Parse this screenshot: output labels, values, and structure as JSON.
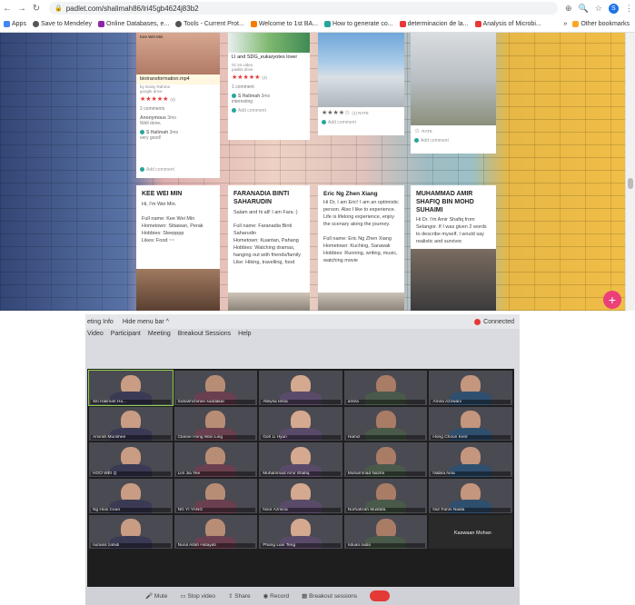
{
  "browser": {
    "url": "padlet.com/shalimah86/lri45gb4624j83b2",
    "bookmarks": [
      {
        "label": "Apps",
        "color": "#4285f4"
      },
      {
        "label": "Save to Mendeley",
        "color": "#555555"
      },
      {
        "label": "Online Databases, e...",
        "color": "#8e24aa"
      },
      {
        "label": "Tools - Current Prot...",
        "color": "#555555"
      },
      {
        "label": "Welcome to 1st BA...",
        "color": "#f57c00"
      },
      {
        "label": "How to generate co...",
        "color": "#26a69a"
      },
      {
        "label": "determinacion de la...",
        "color": "#e53935"
      },
      {
        "label": "Analysis of Microbi...",
        "color": "#e53935"
      }
    ],
    "other_bookmarks": "Other bookmarks",
    "profile_letter": "S"
  },
  "padlet": {
    "top_cards": [
      {
        "header": "Kee Wei Min",
        "title": "biotransformation.mp4",
        "by": "by Daisy Rahma",
        "source": "google drive",
        "comments_count": "2 comments",
        "comments": [
          {
            "author": "Anonymous",
            "time": "3mo",
            "text": "Well done,"
          },
          {
            "author": "S Halimah",
            "time": "3mo",
            "text": "very good!"
          }
        ],
        "add": "Add comment"
      },
      {
        "title": "LI and SDG_eukaryotes lover",
        "sub1": "01:44 video",
        "sub2": "padlet drive",
        "comments_count": "1 comment",
        "comments": [
          {
            "author": "S Halimah",
            "time": "3mo",
            "text": "interesting"
          }
        ],
        "add": "Add comment"
      },
      {
        "rate": "RATE",
        "add": "Add comment"
      },
      {
        "rate": "RATE",
        "add": "Add comment"
      }
    ],
    "bottom_cards": [
      {
        "name": "KEE WEI MIN",
        "body": "Hi, I'm Wei Min.\n\nFull name: Kee Wei Min\nHometown: Sitiawan, Perak\nHobbies: Sleepppp\nLikes: Food ~~"
      },
      {
        "name": "FARANADIA BINTI SAHARUDIN",
        "body": "Salam and hi all! I am Fara :)\n\nFull name: Faranadia Binti Saharudin\nHometown: Kuantan, Pahang\nHobbies: Watching dramas, hanging out with friends/family\nLike: Hiking, travelling, food"
      },
      {
        "name": "Eric Ng Zhen Xiang",
        "body": "Hi Dr, I am Eric! I am an optimistic person. Also I like to experience.\nLife is lifelong experience, enjoy the scenary along the journey.\n\nFull name: Eric Ng Zhen Xiang\nHometown: Kuching, Sarawak\nHobbies: Running, writing, music, watching movie"
      },
      {
        "name": "MUHAMMAD AMIR SHAFIQ BIN MOHD SUHAIMI",
        "body": "Hi Dr. I'm Amir Shafiq from Selangor. If I was given 2 words to describe myself, I would say realistic and survivor."
      }
    ]
  },
  "zoom": {
    "menu1": [
      "eting Info",
      "Hide menu bar ^"
    ],
    "connected": "Connected",
    "menu2": [
      "Video",
      "Participant",
      "Meeting",
      "Breakout Sessions",
      "Help"
    ],
    "participants": [
      "Siti Halimah Ha...",
      "Subashchinee suddakar",
      "Alleysa Iema",
      "amira",
      "Amira Azzwani",
      "Amirah Munshee",
      "Clarine Hong Wan Ling",
      "Goh Li Hyun",
      "Hamiz",
      "Hong Choon Kent",
      "HOO WEI Q",
      "Lim Jia Yee",
      "Muhammad Amir Shafiq",
      "Muhammad Nazmi",
      "Nabila Aina",
      "Ng Hooi Cean",
      "NG YI YANG",
      "Noor Azmina",
      "Norhafizah Mustafa",
      "Nur Fanni Nadia",
      "nurainil zahidi",
      "Nurul Aifah Hidayati",
      "Phang Lian Teng",
      "riduan.radio",
      "Kaswaan Mohan"
    ],
    "toolbar": [
      "Mute",
      "Stop video",
      "Share",
      "Record",
      "Breakout sessions"
    ]
  },
  "colors": {
    "accent": "#ec407a",
    "stars": "#e53935",
    "teal": "#26a69a"
  }
}
